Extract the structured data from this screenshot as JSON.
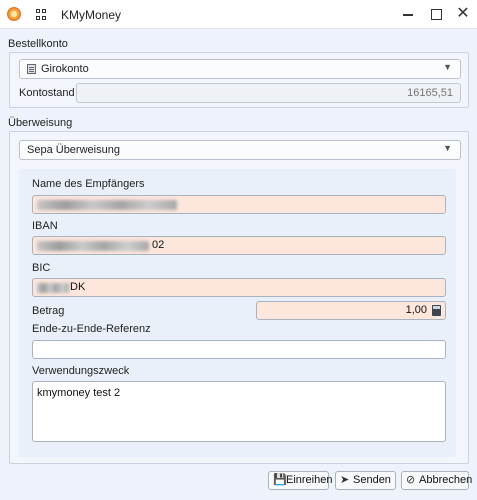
{
  "window": {
    "title": "KMyMoney",
    "close_glyph": "✕"
  },
  "account_section": {
    "label": "Bestellkonto",
    "account_select": {
      "value": "Girokonto",
      "icon": "account-book-icon"
    },
    "balance_label": "Kontostand",
    "balance_value": "16165,51"
  },
  "transfer_section": {
    "label": "Überweisung",
    "type_select": {
      "value": "Sepa Überweisung"
    },
    "recipient_name_label": "Name des Empfängers",
    "iban_label": "IBAN",
    "iban_visible_suffix": "02",
    "bic_label": "BIC",
    "bic_visible_suffix": "DK",
    "amount_label": "Betrag",
    "amount_value": "1,00",
    "reference_label": "Ende-zu-Ende-Referenz",
    "reference_value": "",
    "purpose_label": "Verwendungszweck",
    "purpose_value": "kmymoney test 2"
  },
  "buttons": {
    "enqueue": "Einreihen",
    "send": "Senden",
    "cancel": "Abbrechen"
  },
  "colors": {
    "required_field_bg": "#fde6dc",
    "window_bg": "#eef3fb"
  }
}
